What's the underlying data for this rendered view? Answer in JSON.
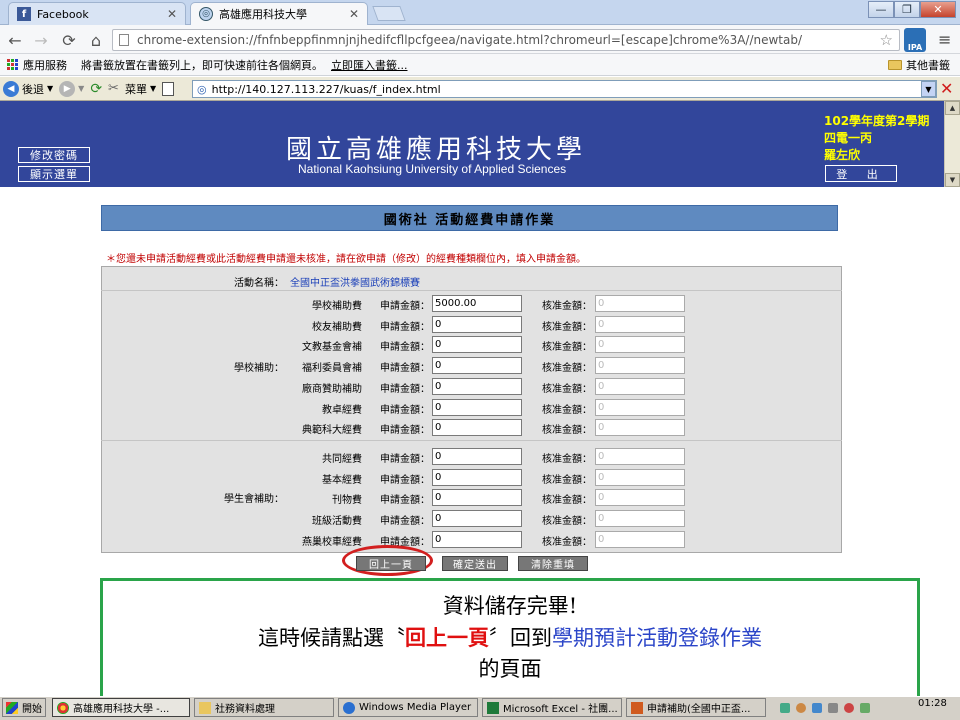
{
  "browser": {
    "tabs": [
      {
        "title": "Facebook",
        "favicon": "facebook-icon",
        "active": false
      },
      {
        "title": "高雄應用科技大學",
        "favicon": "globe-icon",
        "active": true
      }
    ],
    "omnibox_url": "chrome-extension://fnfnbeppfinmnjnjhedifcfllpcfgeea/navigate.html?chromeurl=[escape]chrome%3A//newtab/",
    "bookmarks": {
      "apps_label": "應用服務",
      "hint": "將書籤放置在書籤列上，即可快速前往各個網頁。",
      "import_link": "立即匯入書籤...",
      "other_label": "其他書籤"
    },
    "window_controls": [
      "—",
      "❐",
      "✕"
    ]
  },
  "ie_bar": {
    "back_label": "後退",
    "menu_label": "菜單",
    "address": "http://140.127.113.227/kuas/f_index.html"
  },
  "header": {
    "title_zh": "國立高雄應用科技大學",
    "title_en": "National Kaohsiung University of Applied Sciences",
    "change_password": "修改密碼",
    "show_menu": "顯示選單",
    "semester": "102學年度第2學期",
    "class_name": "四電一丙",
    "student_name": "羅左欣",
    "logout": "登 出"
  },
  "form": {
    "title": "國術社 活動經費申請作業",
    "notice": "＊您還未申請活動經費或此活動經費申請還未核准，請在欲申請（修改）的經費種類欄位內，填入申請金額。",
    "activity_label": "活動名稱：",
    "activity_name": "全國中正盃洪拳國武術錦標賽",
    "apply_label": "申請金額：",
    "approve_label": "核准金額：",
    "school_group": {
      "label": "學校補助：",
      "items": [
        {
          "name": "學校補助費",
          "apply": "5000.00",
          "approve": "0"
        },
        {
          "name": "校友補助費",
          "apply": "0",
          "approve": "0"
        },
        {
          "name": "文教基金會補",
          "apply": "0",
          "approve": "0"
        },
        {
          "name": "福利委員會補",
          "apply": "0",
          "approve": "0"
        },
        {
          "name": "廠商贊助補助",
          "apply": "0",
          "approve": "0"
        },
        {
          "name": "教卓經費",
          "apply": "0",
          "approve": "0"
        },
        {
          "name": "典範科大經費",
          "apply": "0",
          "approve": "0"
        }
      ]
    },
    "student_group": {
      "label": "學生會補助：",
      "items": [
        {
          "name": "共同經費",
          "apply": "0",
          "approve": "0"
        },
        {
          "name": "基本經費",
          "apply": "0",
          "approve": "0"
        },
        {
          "name": "刊物費",
          "apply": "0",
          "approve": "0"
        },
        {
          "name": "班級活動費",
          "apply": "0",
          "approve": "0"
        },
        {
          "name": "燕巢校車經費",
          "apply": "0",
          "approve": "0"
        }
      ]
    },
    "buttons": {
      "back": "回上一頁",
      "submit": "確定送出",
      "reset": "清除重填"
    }
  },
  "callout": {
    "line1": "資料儲存完畢!",
    "line2_prefix": "這時候請點選〝",
    "line2_highlight": "回上一頁",
    "line2_mid": "〞回到",
    "line2_link": "學期預計活動登錄作業",
    "line3": "的頁面"
  },
  "taskbar": {
    "start": "開始",
    "items": [
      "高雄應用科技大學 -...",
      "社務資料處理",
      "Windows Media Player",
      "Microsoft Excel - 社團...",
      "申請補助(全國中正盃..."
    ],
    "clock": "01:28"
  },
  "colors": {
    "banner": "#32469b",
    "form_title": "#5f8ac0",
    "notice": "#c00000",
    "callout_border": "#2aa44a",
    "highlight": "#e01010",
    "link_blue": "#2b45c8"
  }
}
